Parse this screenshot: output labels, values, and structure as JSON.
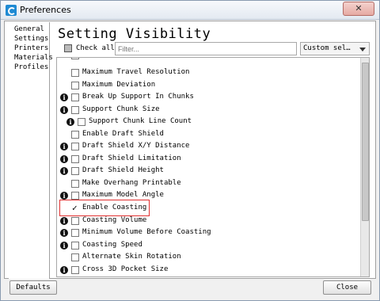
{
  "window": {
    "title": "Preferences",
    "close_glyph": "✕"
  },
  "sidebar": {
    "items": [
      "General",
      "Settings",
      "Printers",
      "Materials",
      "Profiles"
    ]
  },
  "main": {
    "heading": "Setting Visibility",
    "check_all_label": "Check all",
    "filter_placeholder": "Filter...",
    "dropdown_value": "Custom sel…"
  },
  "settings": [
    {
      "label": "Maximum Travel Resolution",
      "checked": false,
      "info": false
    },
    {
      "label": "Maximum Deviation",
      "checked": false,
      "info": false
    },
    {
      "label": "Break Up Support In Chunks",
      "checked": false,
      "info": true
    },
    {
      "label": "Support Chunk Size",
      "checked": false,
      "info": true
    },
    {
      "label": "Support Chunk Line Count",
      "checked": false,
      "info": true
    },
    {
      "label": "Enable Draft Shield",
      "checked": false,
      "info": false
    },
    {
      "label": "Draft Shield X/Y Distance",
      "checked": false,
      "info": true
    },
    {
      "label": "Draft Shield Limitation",
      "checked": false,
      "info": true
    },
    {
      "label": "Draft Shield Height",
      "checked": false,
      "info": true
    },
    {
      "label": "Make Overhang Printable",
      "checked": false,
      "info": false
    },
    {
      "label": "Maximum Model Angle",
      "checked": false,
      "info": true
    },
    {
      "label": "Enable Coasting",
      "checked": true,
      "info": false
    },
    {
      "label": "Coasting Volume",
      "checked": false,
      "info": true
    },
    {
      "label": "Minimum Volume Before Coasting",
      "checked": false,
      "info": true
    },
    {
      "label": "Coasting Speed",
      "checked": false,
      "info": true
    },
    {
      "label": "Alternate Skin Rotation",
      "checked": false,
      "info": false
    },
    {
      "label": "Cross 3D Pocket Size",
      "checked": false,
      "info": true
    }
  ],
  "footer": {
    "defaults_label": "Defaults",
    "close_label": "Close"
  },
  "colors": {
    "highlight_border": "#e03030",
    "app_icon": "#1f8ad3"
  }
}
